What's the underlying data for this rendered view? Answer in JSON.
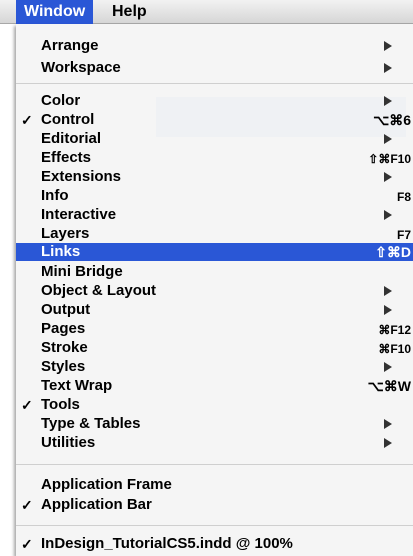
{
  "menubar": {
    "window_label": "Window",
    "help_label": "Help"
  },
  "menu": {
    "items": [
      {
        "label": "Arrange",
        "checked": false,
        "submenu": true,
        "shortcut": ""
      },
      {
        "label": "Workspace",
        "checked": false,
        "submenu": true,
        "shortcut": ""
      },
      {
        "label": "Color",
        "checked": false,
        "submenu": true,
        "shortcut": ""
      },
      {
        "label": "Control",
        "checked": true,
        "submenu": false,
        "shortcut": "⌥⌘6"
      },
      {
        "label": "Editorial",
        "checked": false,
        "submenu": true,
        "shortcut": ""
      },
      {
        "label": "Effects",
        "checked": false,
        "submenu": false,
        "shortcut": "⇧⌘F10"
      },
      {
        "label": "Extensions",
        "checked": false,
        "submenu": true,
        "shortcut": ""
      },
      {
        "label": "Info",
        "checked": false,
        "submenu": false,
        "shortcut": "F8"
      },
      {
        "label": "Interactive",
        "checked": false,
        "submenu": true,
        "shortcut": ""
      },
      {
        "label": "Layers",
        "checked": false,
        "submenu": false,
        "shortcut": "F7"
      },
      {
        "label": "Links",
        "checked": false,
        "submenu": false,
        "shortcut": "⇧⌘D",
        "highlighted": true
      },
      {
        "label": "Mini Bridge",
        "checked": false,
        "submenu": false,
        "shortcut": ""
      },
      {
        "label": "Object & Layout",
        "checked": false,
        "submenu": true,
        "shortcut": ""
      },
      {
        "label": "Output",
        "checked": false,
        "submenu": true,
        "shortcut": ""
      },
      {
        "label": "Pages",
        "checked": false,
        "submenu": false,
        "shortcut": "⌘F12"
      },
      {
        "label": "Stroke",
        "checked": false,
        "submenu": false,
        "shortcut": "⌘F10"
      },
      {
        "label": "Styles",
        "checked": false,
        "submenu": true,
        "shortcut": ""
      },
      {
        "label": "Text Wrap",
        "checked": false,
        "submenu": false,
        "shortcut": "⌥⌘W"
      },
      {
        "label": "Tools",
        "checked": true,
        "submenu": false,
        "shortcut": ""
      },
      {
        "label": "Type & Tables",
        "checked": false,
        "submenu": true,
        "shortcut": ""
      },
      {
        "label": "Utilities",
        "checked": false,
        "submenu": true,
        "shortcut": ""
      },
      {
        "label": "Application Frame",
        "checked": false,
        "submenu": false,
        "shortcut": ""
      },
      {
        "label": "Application Bar",
        "checked": true,
        "submenu": false,
        "shortcut": ""
      },
      {
        "label": "InDesign_TutorialCS5.indd @ 100%",
        "checked": true,
        "submenu": false,
        "shortcut": ""
      }
    ],
    "check_glyph": "✓"
  },
  "colors": {
    "highlight": "#2a57d6",
    "menu_background": "#f5f5f5",
    "separator": "#cfcfcf"
  }
}
